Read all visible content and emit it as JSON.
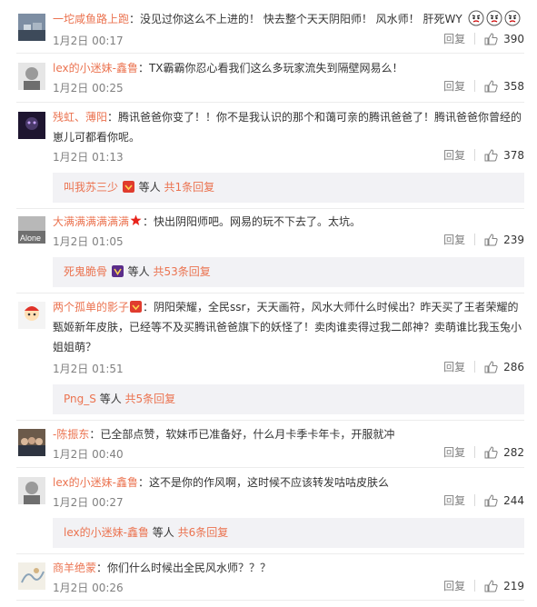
{
  "comments": [
    {
      "user": "一坨咸鱼路上跑",
      "text": "：没见过你这么不上进的！ 快去整个天天阴阳师！ 风水师！ 肝死WY",
      "time": "1月2日 00:17",
      "reply_label": "回复",
      "likes": "390",
      "avatar": "landscape",
      "emojis": [
        "angry-face-icon",
        "angry-face-icon",
        "angry-face-icon"
      ]
    },
    {
      "user": "lex的小迷妹-鑫鲁",
      "text": "：TX霸霸你忍心看我们这么多玩家流失到隔壁网易么！",
      "time": "1月2日 00:25",
      "reply_label": "回复",
      "likes": "358",
      "avatar": "portrait-gray"
    },
    {
      "user": "残虹、薄阳",
      "text_line1": "：腾讯爸爸你变了！！你不是我认识的那个和蔼可亲的腾讯爸爸了！腾讯爸爸你曾经的",
      "text_line2": "崽儿可都看你呢。",
      "time": "1月2日 01:13",
      "reply_label": "回复",
      "likes": "378",
      "avatar": "dark",
      "sub": {
        "user": "叫我苏三少",
        "tail_prefix": "等人",
        "count": "共1条回复"
      }
    },
    {
      "user": "大满满满满满满",
      "text": "：快出阴阳师吧。网易的玩不下去了。太坑。",
      "time": "1月2日 01:05",
      "reply_label": "回复",
      "likes": "239",
      "avatar": "alone",
      "avatar_text": "Alone",
      "sub": {
        "user": "死鬼脆骨",
        "tail_prefix": "等人",
        "count": "共53条回复"
      }
    },
    {
      "user": "两个孤单的影子",
      "text_line1": "：阴阳荣耀，全民ssr，天天画符，风水大师什么时候出？昨天买了王者荣耀的",
      "text_line2": "甄姬新年皮肤，已经等不及买腾讯爸爸旗下的妖怪了！卖肉谁卖得过我二郎神？卖萌谁比我玉兔小",
      "text_line3": "姐姐萌？",
      "time": "1月2日 01:51",
      "reply_label": "回复",
      "likes": "286",
      "avatar": "cartoon",
      "sub": {
        "user": "Png_S",
        "tail_prefix": "等人",
        "count": "共5条回复"
      }
    },
    {
      "user": "-陈振东",
      "text": "：已全部点赞，软妹币已准备好，什么月卡季卡年卡，开服就冲",
      "time": "1月2日 00:40",
      "reply_label": "回复",
      "likes": "282",
      "avatar": "group"
    },
    {
      "user": "lex的小迷妹-鑫鲁",
      "text": "：这不是你的作风啊，这时候不应该转发咕咕皮肤么",
      "time": "1月2日 00:27",
      "reply_label": "回复",
      "likes": "244",
      "avatar": "portrait-gray",
      "sub": {
        "user": "lex的小迷妹-鑫鲁",
        "tail_prefix": "等人",
        "count": "共6条回复"
      }
    },
    {
      "user": "商羊绝蒙",
      "text": "：你们什么时候出全民风水师？？？",
      "time": "1月2日 00:26",
      "reply_label": "回复",
      "likes": "219",
      "avatar": "sketch"
    }
  ],
  "colors": {
    "username": "#eb7350",
    "meta": "#808080",
    "subbox_bg": "#f2f2f5"
  }
}
